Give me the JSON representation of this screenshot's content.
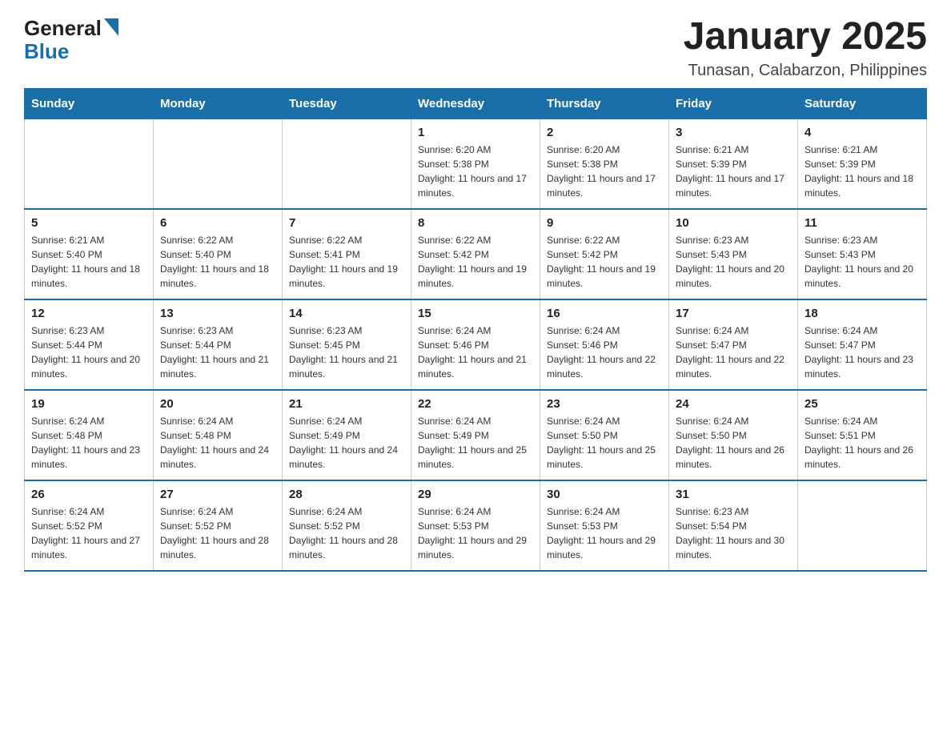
{
  "header": {
    "logo": {
      "general": "General",
      "blue": "Blue",
      "triangle_color": "#1a6fa8"
    },
    "title": "January 2025",
    "subtitle": "Tunasan, Calabarzon, Philippines"
  },
  "calendar": {
    "days_of_week": [
      "Sunday",
      "Monday",
      "Tuesday",
      "Wednesday",
      "Thursday",
      "Friday",
      "Saturday"
    ],
    "weeks": [
      {
        "days": [
          {
            "number": "",
            "sunrise": "",
            "sunset": "",
            "daylight": ""
          },
          {
            "number": "",
            "sunrise": "",
            "sunset": "",
            "daylight": ""
          },
          {
            "number": "",
            "sunrise": "",
            "sunset": "",
            "daylight": ""
          },
          {
            "number": "1",
            "sunrise": "Sunrise: 6:20 AM",
            "sunset": "Sunset: 5:38 PM",
            "daylight": "Daylight: 11 hours and 17 minutes."
          },
          {
            "number": "2",
            "sunrise": "Sunrise: 6:20 AM",
            "sunset": "Sunset: 5:38 PM",
            "daylight": "Daylight: 11 hours and 17 minutes."
          },
          {
            "number": "3",
            "sunrise": "Sunrise: 6:21 AM",
            "sunset": "Sunset: 5:39 PM",
            "daylight": "Daylight: 11 hours and 17 minutes."
          },
          {
            "number": "4",
            "sunrise": "Sunrise: 6:21 AM",
            "sunset": "Sunset: 5:39 PM",
            "daylight": "Daylight: 11 hours and 18 minutes."
          }
        ]
      },
      {
        "days": [
          {
            "number": "5",
            "sunrise": "Sunrise: 6:21 AM",
            "sunset": "Sunset: 5:40 PM",
            "daylight": "Daylight: 11 hours and 18 minutes."
          },
          {
            "number": "6",
            "sunrise": "Sunrise: 6:22 AM",
            "sunset": "Sunset: 5:40 PM",
            "daylight": "Daylight: 11 hours and 18 minutes."
          },
          {
            "number": "7",
            "sunrise": "Sunrise: 6:22 AM",
            "sunset": "Sunset: 5:41 PM",
            "daylight": "Daylight: 11 hours and 19 minutes."
          },
          {
            "number": "8",
            "sunrise": "Sunrise: 6:22 AM",
            "sunset": "Sunset: 5:42 PM",
            "daylight": "Daylight: 11 hours and 19 minutes."
          },
          {
            "number": "9",
            "sunrise": "Sunrise: 6:22 AM",
            "sunset": "Sunset: 5:42 PM",
            "daylight": "Daylight: 11 hours and 19 minutes."
          },
          {
            "number": "10",
            "sunrise": "Sunrise: 6:23 AM",
            "sunset": "Sunset: 5:43 PM",
            "daylight": "Daylight: 11 hours and 20 minutes."
          },
          {
            "number": "11",
            "sunrise": "Sunrise: 6:23 AM",
            "sunset": "Sunset: 5:43 PM",
            "daylight": "Daylight: 11 hours and 20 minutes."
          }
        ]
      },
      {
        "days": [
          {
            "number": "12",
            "sunrise": "Sunrise: 6:23 AM",
            "sunset": "Sunset: 5:44 PM",
            "daylight": "Daylight: 11 hours and 20 minutes."
          },
          {
            "number": "13",
            "sunrise": "Sunrise: 6:23 AM",
            "sunset": "Sunset: 5:44 PM",
            "daylight": "Daylight: 11 hours and 21 minutes."
          },
          {
            "number": "14",
            "sunrise": "Sunrise: 6:23 AM",
            "sunset": "Sunset: 5:45 PM",
            "daylight": "Daylight: 11 hours and 21 minutes."
          },
          {
            "number": "15",
            "sunrise": "Sunrise: 6:24 AM",
            "sunset": "Sunset: 5:46 PM",
            "daylight": "Daylight: 11 hours and 21 minutes."
          },
          {
            "number": "16",
            "sunrise": "Sunrise: 6:24 AM",
            "sunset": "Sunset: 5:46 PM",
            "daylight": "Daylight: 11 hours and 22 minutes."
          },
          {
            "number": "17",
            "sunrise": "Sunrise: 6:24 AM",
            "sunset": "Sunset: 5:47 PM",
            "daylight": "Daylight: 11 hours and 22 minutes."
          },
          {
            "number": "18",
            "sunrise": "Sunrise: 6:24 AM",
            "sunset": "Sunset: 5:47 PM",
            "daylight": "Daylight: 11 hours and 23 minutes."
          }
        ]
      },
      {
        "days": [
          {
            "number": "19",
            "sunrise": "Sunrise: 6:24 AM",
            "sunset": "Sunset: 5:48 PM",
            "daylight": "Daylight: 11 hours and 23 minutes."
          },
          {
            "number": "20",
            "sunrise": "Sunrise: 6:24 AM",
            "sunset": "Sunset: 5:48 PM",
            "daylight": "Daylight: 11 hours and 24 minutes."
          },
          {
            "number": "21",
            "sunrise": "Sunrise: 6:24 AM",
            "sunset": "Sunset: 5:49 PM",
            "daylight": "Daylight: 11 hours and 24 minutes."
          },
          {
            "number": "22",
            "sunrise": "Sunrise: 6:24 AM",
            "sunset": "Sunset: 5:49 PM",
            "daylight": "Daylight: 11 hours and 25 minutes."
          },
          {
            "number": "23",
            "sunrise": "Sunrise: 6:24 AM",
            "sunset": "Sunset: 5:50 PM",
            "daylight": "Daylight: 11 hours and 25 minutes."
          },
          {
            "number": "24",
            "sunrise": "Sunrise: 6:24 AM",
            "sunset": "Sunset: 5:50 PM",
            "daylight": "Daylight: 11 hours and 26 minutes."
          },
          {
            "number": "25",
            "sunrise": "Sunrise: 6:24 AM",
            "sunset": "Sunset: 5:51 PM",
            "daylight": "Daylight: 11 hours and 26 minutes."
          }
        ]
      },
      {
        "days": [
          {
            "number": "26",
            "sunrise": "Sunrise: 6:24 AM",
            "sunset": "Sunset: 5:52 PM",
            "daylight": "Daylight: 11 hours and 27 minutes."
          },
          {
            "number": "27",
            "sunrise": "Sunrise: 6:24 AM",
            "sunset": "Sunset: 5:52 PM",
            "daylight": "Daylight: 11 hours and 28 minutes."
          },
          {
            "number": "28",
            "sunrise": "Sunrise: 6:24 AM",
            "sunset": "Sunset: 5:52 PM",
            "daylight": "Daylight: 11 hours and 28 minutes."
          },
          {
            "number": "29",
            "sunrise": "Sunrise: 6:24 AM",
            "sunset": "Sunset: 5:53 PM",
            "daylight": "Daylight: 11 hours and 29 minutes."
          },
          {
            "number": "30",
            "sunrise": "Sunrise: 6:24 AM",
            "sunset": "Sunset: 5:53 PM",
            "daylight": "Daylight: 11 hours and 29 minutes."
          },
          {
            "number": "31",
            "sunrise": "Sunrise: 6:23 AM",
            "sunset": "Sunset: 5:54 PM",
            "daylight": "Daylight: 11 hours and 30 minutes."
          },
          {
            "number": "",
            "sunrise": "",
            "sunset": "",
            "daylight": ""
          }
        ]
      }
    ]
  }
}
